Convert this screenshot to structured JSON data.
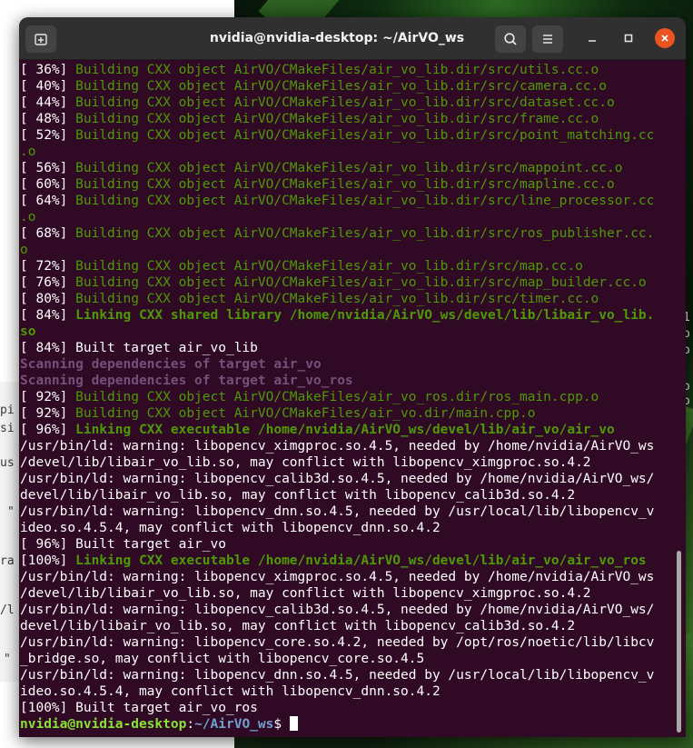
{
  "window": {
    "title": "nvidia@nvidia-desktop: ~/AirVO_ws"
  },
  "icons": {
    "new_tab": "new-tab-icon",
    "search": "search-icon",
    "menu": "hamburger-menu-icon",
    "minimize": "minimize-icon",
    "maximize": "maximize-icon",
    "close": "close-icon"
  },
  "colors": {
    "terminal_bg": "#300a24",
    "headerbar_bg": "#303030",
    "green": "#4e9a06",
    "magenta": "#75507b",
    "prompt_user": "#8ae234",
    "prompt_path": "#729fcf",
    "close_button": "#e95420"
  },
  "background": {
    "left_fragments": [
      "pi",
      "si",
      "us",
      "\"",
      "ra",
      "/l",
      "\""
    ],
    "right_fragments": [
      "1",
      "o",
      "o",
      "o",
      "o"
    ]
  },
  "terminal": {
    "lines": [
      {
        "prefix": "[ 36%] ",
        "text": "Building CXX object AirVO/CMakeFiles/air_vo_lib.dir/src/utils.cc.o",
        "style": "green"
      },
      {
        "prefix": "[ 40%] ",
        "text": "Building CXX object AirVO/CMakeFiles/air_vo_lib.dir/src/camera.cc.o",
        "style": "green"
      },
      {
        "prefix": "[ 44%] ",
        "text": "Building CXX object AirVO/CMakeFiles/air_vo_lib.dir/src/dataset.cc.o",
        "style": "green"
      },
      {
        "prefix": "[ 48%] ",
        "text": "Building CXX object AirVO/CMakeFiles/air_vo_lib.dir/src/frame.cc.o",
        "style": "green"
      },
      {
        "prefix": "[ 52%] ",
        "text": "Building CXX object AirVO/CMakeFiles/air_vo_lib.dir/src/point_matching.cc",
        "style": "green"
      },
      {
        "prefix": "",
        "text": ".o",
        "style": "green"
      },
      {
        "prefix": "[ 56%] ",
        "text": "Building CXX object AirVO/CMakeFiles/air_vo_lib.dir/src/mappoint.cc.o",
        "style": "green"
      },
      {
        "prefix": "[ 60%] ",
        "text": "Building CXX object AirVO/CMakeFiles/air_vo_lib.dir/src/mapline.cc.o",
        "style": "green"
      },
      {
        "prefix": "[ 64%] ",
        "text": "Building CXX object AirVO/CMakeFiles/air_vo_lib.dir/src/line_processor.cc",
        "style": "green"
      },
      {
        "prefix": "",
        "text": ".o",
        "style": "green"
      },
      {
        "prefix": "[ 68%] ",
        "text": "Building CXX object AirVO/CMakeFiles/air_vo_lib.dir/src/ros_publisher.cc.",
        "style": "green"
      },
      {
        "prefix": "",
        "text": "o",
        "style": "green"
      },
      {
        "prefix": "[ 72%] ",
        "text": "Building CXX object AirVO/CMakeFiles/air_vo_lib.dir/src/map.cc.o",
        "style": "green"
      },
      {
        "prefix": "[ 76%] ",
        "text": "Building CXX object AirVO/CMakeFiles/air_vo_lib.dir/src/map_builder.cc.o",
        "style": "green"
      },
      {
        "prefix": "[ 80%] ",
        "text": "Building CXX object AirVO/CMakeFiles/air_vo_lib.dir/src/timer.cc.o",
        "style": "green"
      },
      {
        "prefix": "[ 84%] ",
        "text": "Linking CXX shared library /home/nvidia/AirVO_ws/devel/lib/libair_vo_lib.",
        "style": "green-bold"
      },
      {
        "prefix": "",
        "text": "so",
        "style": "green-bold"
      },
      {
        "prefix": "",
        "text": "[ 84%] Built target air_vo_lib",
        "style": "plain"
      },
      {
        "prefix": "",
        "text": "Scanning dependencies of target air_vo",
        "style": "magenta-bold"
      },
      {
        "prefix": "",
        "text": "Scanning dependencies of target air_vo_ros",
        "style": "magenta-bold"
      },
      {
        "prefix": "[ 92%] ",
        "text": "Building CXX object AirVO/CMakeFiles/air_vo_ros.dir/ros_main.cpp.o",
        "style": "green"
      },
      {
        "prefix": "[ 92%] ",
        "text": "Building CXX object AirVO/CMakeFiles/air_vo.dir/main.cpp.o",
        "style": "green"
      },
      {
        "prefix": "[ 96%] ",
        "text": "Linking CXX executable /home/nvidia/AirVO_ws/devel/lib/air_vo/air_vo",
        "style": "green-bold"
      },
      {
        "prefix": "",
        "text": "/usr/bin/ld: warning: libopencv_ximgproc.so.4.5, needed by /home/nvidia/AirVO_ws",
        "style": "plain"
      },
      {
        "prefix": "",
        "text": "/devel/lib/libair_vo_lib.so, may conflict with libopencv_ximgproc.so.4.2",
        "style": "plain"
      },
      {
        "prefix": "",
        "text": "/usr/bin/ld: warning: libopencv_calib3d.so.4.5, needed by /home/nvidia/AirVO_ws/",
        "style": "plain"
      },
      {
        "prefix": "",
        "text": "devel/lib/libair_vo_lib.so, may conflict with libopencv_calib3d.so.4.2",
        "style": "plain"
      },
      {
        "prefix": "",
        "text": "/usr/bin/ld: warning: libopencv_dnn.so.4.5, needed by /usr/local/lib/libopencv_v",
        "style": "plain"
      },
      {
        "prefix": "",
        "text": "ideo.so.4.5.4, may conflict with libopencv_dnn.so.4.2",
        "style": "plain"
      },
      {
        "prefix": "",
        "text": "[ 96%] Built target air_vo",
        "style": "plain"
      },
      {
        "prefix": "[100%] ",
        "text": "Linking CXX executable /home/nvidia/AirVO_ws/devel/lib/air_vo/air_vo_ros",
        "style": "green-bold"
      },
      {
        "prefix": "",
        "text": "/usr/bin/ld: warning: libopencv_ximgproc.so.4.5, needed by /home/nvidia/AirVO_ws",
        "style": "plain"
      },
      {
        "prefix": "",
        "text": "/devel/lib/libair_vo_lib.so, may conflict with libopencv_ximgproc.so.4.2",
        "style": "plain"
      },
      {
        "prefix": "",
        "text": "/usr/bin/ld: warning: libopencv_calib3d.so.4.5, needed by /home/nvidia/AirVO_ws/",
        "style": "plain"
      },
      {
        "prefix": "",
        "text": "devel/lib/libair_vo_lib.so, may conflict with libopencv_calib3d.so.4.2",
        "style": "plain"
      },
      {
        "prefix": "",
        "text": "/usr/bin/ld: warning: libopencv_core.so.4.2, needed by /opt/ros/noetic/lib/libcv",
        "style": "plain"
      },
      {
        "prefix": "",
        "text": "_bridge.so, may conflict with libopencv_core.so.4.5",
        "style": "plain"
      },
      {
        "prefix": "",
        "text": "/usr/bin/ld: warning: libopencv_dnn.so.4.5, needed by /usr/local/lib/libopencv_v",
        "style": "plain"
      },
      {
        "prefix": "",
        "text": "ideo.so.4.5.4, may conflict with libopencv_dnn.so.4.2",
        "style": "plain"
      },
      {
        "prefix": "",
        "text": "[100%] Built target air_vo_ros",
        "style": "plain"
      }
    ],
    "prompt": {
      "user_host": "nvidia@nvidia-desktop",
      "colon": ":",
      "path": "~/AirVO_ws",
      "symbol": "$"
    }
  }
}
